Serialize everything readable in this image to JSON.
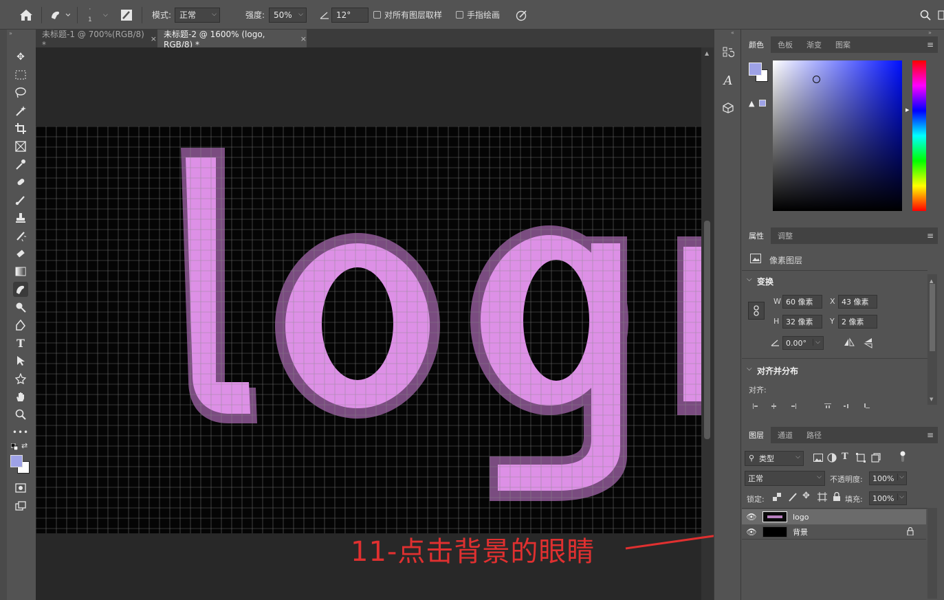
{
  "options_bar": {
    "mode_label": "模式:",
    "mode_value": "正常",
    "strength_label": "强度:",
    "strength_value": "50%",
    "angle_value": "12°",
    "brush_size": "1",
    "sample_all_layers": "对所有图层取样",
    "finger_painting": "手指绘画"
  },
  "tabs": [
    {
      "label": "未标题-1 @ 700%(RGB/8) *",
      "active": false
    },
    {
      "label": "未标题-2 @ 1600% (logo, RGB/8) *",
      "active": true
    }
  ],
  "canvas": {
    "text": "log",
    "grid_color": "#8a8a8a",
    "glyph_color": "#dd90e6",
    "edge_color": "#7a4c80",
    "background": "#050505"
  },
  "annotation": {
    "text": "11-点击背景的眼睛",
    "color": "#e03030"
  },
  "color_panel": {
    "tabs": [
      "颜色",
      "色板",
      "渐变",
      "图案"
    ],
    "foreground": "#9ea2e6",
    "hue_color": "#0010ff"
  },
  "properties_panel": {
    "tabs": [
      "属性",
      "调整"
    ],
    "layer_type": "像素图层",
    "transform_title": "变换",
    "w_label": "W",
    "w_value": "60 像素",
    "x_label": "X",
    "x_value": "43 像素",
    "h_label": "H",
    "h_value": "32 像素",
    "y_label": "Y",
    "y_value": "2 像素",
    "angle_value": "0.00°",
    "align_title": "对齐并分布",
    "align_label": "对齐:"
  },
  "layers_panel": {
    "tabs": [
      "图层",
      "通道",
      "路径"
    ],
    "filter_label": "类型",
    "blend_mode": "正常",
    "opacity_label": "不透明度:",
    "opacity_value": "100%",
    "lock_label": "锁定:",
    "fill_label": "填充:",
    "fill_value": "100%",
    "layers": [
      {
        "name": "logo",
        "selected": true
      },
      {
        "name": "背景",
        "selected": false,
        "locked": true
      }
    ]
  }
}
